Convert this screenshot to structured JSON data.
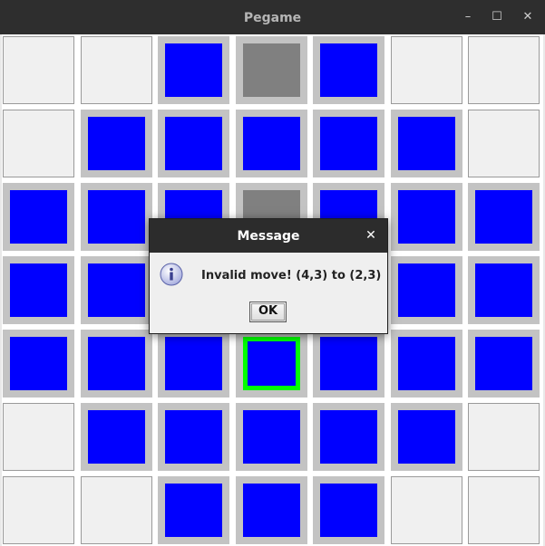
{
  "window": {
    "title": "Pegame",
    "controls": {
      "minimize": "–",
      "maximize": "☐",
      "close": "✕"
    }
  },
  "board": {
    "rows": 7,
    "cols": 7,
    "cells": [
      [
        "empty",
        "empty",
        "peg",
        "hole",
        "peg",
        "empty",
        "empty"
      ],
      [
        "empty",
        "peg",
        "peg",
        "peg",
        "peg",
        "peg",
        "empty"
      ],
      [
        "peg",
        "peg",
        "peg",
        "hole",
        "peg",
        "peg",
        "peg"
      ],
      [
        "peg",
        "peg",
        "peg",
        "peg",
        "peg",
        "peg",
        "peg"
      ],
      [
        "peg",
        "peg",
        "peg",
        "selected",
        "peg",
        "peg",
        "peg"
      ],
      [
        "empty",
        "peg",
        "peg",
        "peg",
        "peg",
        "peg",
        "empty"
      ],
      [
        "empty",
        "empty",
        "peg",
        "peg",
        "peg",
        "empty",
        "empty"
      ]
    ],
    "colors": {
      "peg": "#0000ff",
      "hole": "#808080",
      "selected_border": "#00ff00",
      "cell_frame": "#c3c3c3",
      "empty": "#f0f0f0"
    }
  },
  "dialog": {
    "title": "Message",
    "close": "✕",
    "icon": "info-icon",
    "message": "Invalid move! (4,3) to (2,3)",
    "ok_label": "OK"
  }
}
